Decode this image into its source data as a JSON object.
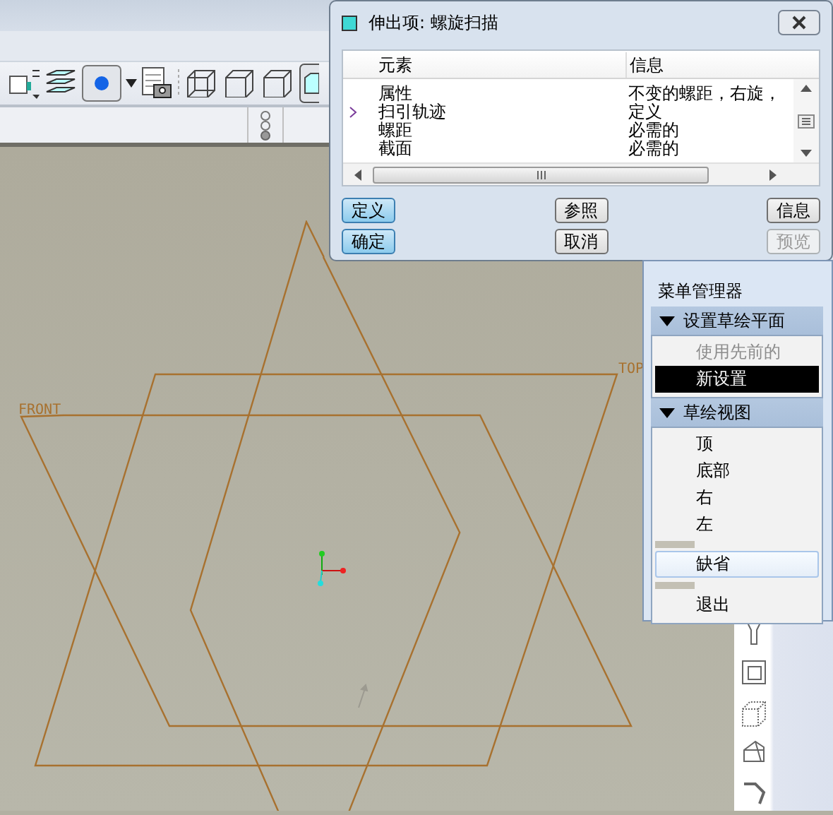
{
  "dialog": {
    "title": "伸出项: 螺旋扫描",
    "columns": [
      "元素",
      "信息"
    ],
    "rows": [
      {
        "element": "属性",
        "info": "不变的螺距，右旋，",
        "current": false
      },
      {
        "element": "扫引轨迹",
        "info": "定义",
        "current": true
      },
      {
        "element": "螺距",
        "info": "必需的",
        "current": false
      },
      {
        "element": "截面",
        "info": "必需的",
        "current": false
      }
    ],
    "buttons": [
      {
        "label": "定义",
        "highlighted": true,
        "disabled": false
      },
      {
        "label": "参照",
        "highlighted": false,
        "disabled": false
      },
      {
        "label": "信息",
        "highlighted": false,
        "disabled": false
      },
      {
        "label": "确定",
        "highlighted": true,
        "disabled": false
      },
      {
        "label": "取消",
        "highlighted": false,
        "disabled": false
      },
      {
        "label": "预览",
        "highlighted": false,
        "disabled": true
      }
    ]
  },
  "canvas": {
    "labels": [
      {
        "text": "FRONT",
        "kind": "front"
      },
      {
        "text": "TOP",
        "kind": "top"
      }
    ]
  },
  "menu_manager": {
    "title": "菜单管理器",
    "sections": [
      {
        "title": "设置草绘平面",
        "expanded": true,
        "items": [
          {
            "label": "使用先前的",
            "selected": false,
            "disabled": true,
            "hover": false
          },
          {
            "label": "新设置",
            "selected": true,
            "disabled": false,
            "hover": false
          }
        ]
      },
      {
        "title": "草绘视图",
        "expanded": true,
        "items": [
          {
            "label": "顶",
            "selected": false,
            "disabled": false,
            "hover": false
          },
          {
            "label": "底部",
            "selected": false,
            "disabled": false,
            "hover": false
          },
          {
            "label": "右",
            "selected": false,
            "disabled": false,
            "hover": false
          },
          {
            "label": "左",
            "selected": false,
            "disabled": false,
            "hover": false
          },
          {
            "label": "缺省",
            "selected": false,
            "disabled": false,
            "hover": true
          },
          {
            "label": "退出",
            "selected": false,
            "disabled": false,
            "hover": false
          }
        ]
      }
    ]
  }
}
